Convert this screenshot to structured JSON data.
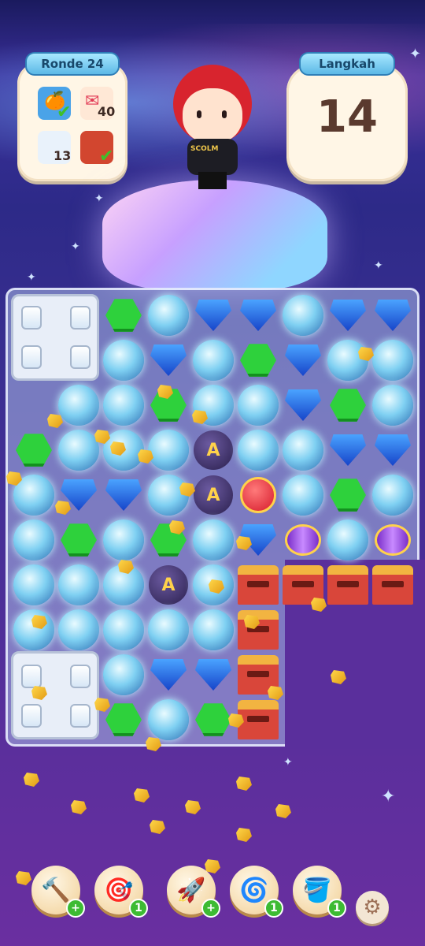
{
  "hud": {
    "round_label": "Ronde 24",
    "moves_label": "Langkah",
    "moves_value": "14",
    "goals": [
      {
        "item": "orange-basket",
        "count": "",
        "completed": true
      },
      {
        "item": "love-letter",
        "count": "40",
        "completed": false
      },
      {
        "item": "milk-jar",
        "count": "13",
        "completed": false
      },
      {
        "item": "gift-box",
        "count": "",
        "completed": true
      }
    ]
  },
  "character": {
    "shirt_text": "SCOLM"
  },
  "board": {
    "dark_tile_symbol": "A",
    "rows": [
      [
        "fridge",
        "fridge",
        "green",
        "bubble",
        "blue",
        "blue",
        "bubble",
        "blue",
        "blue"
      ],
      [
        "fridge",
        "fridge",
        "bubble",
        "blue",
        "bubble",
        "green",
        "blue",
        "bubble",
        "bubble"
      ],
      [
        "empty",
        "bubble",
        "bubble",
        "green",
        "bubble",
        "bubble",
        "blue",
        "green",
        "bubble"
      ],
      [
        "green",
        "bubble",
        "bubble",
        "bubble",
        "dark",
        "bubble",
        "bubble",
        "blue",
        "blue"
      ],
      [
        "bubble",
        "blue",
        "blue",
        "bubble",
        "dark",
        "ball",
        "bubble",
        "green",
        "bubble"
      ],
      [
        "bubble",
        "green",
        "bubble",
        "green",
        "bubble",
        "blue",
        "candy",
        "bubble",
        "candy"
      ],
      [
        "bubble",
        "bubble",
        "bubble",
        "dark",
        "bubble",
        "mailbox",
        "mailbox",
        "mailbox",
        "mailbox"
      ],
      [
        "bubble",
        "bubble",
        "bubble",
        "bubble",
        "bubble",
        "mailbox",
        "",
        "",
        ""
      ],
      [
        "fridge",
        "fridge",
        "bubble",
        "blue",
        "blue",
        "mailbox",
        "",
        "",
        ""
      ],
      [
        "fridge",
        "fridge",
        "green",
        "bubble",
        "green",
        "mailbox",
        "",
        "",
        ""
      ]
    ]
  },
  "boosters": [
    {
      "name": "hammer",
      "badge": "+"
    },
    {
      "name": "cannon",
      "badge": "1"
    },
    {
      "name": "rocket",
      "badge": "+"
    },
    {
      "name": "pinwheel",
      "badge": "1"
    },
    {
      "name": "paint-bucket",
      "badge": "1"
    }
  ],
  "colors": {
    "accent_green": "#3dbb33",
    "hud_tab_blue": "#5cb8e6",
    "bg_purple": "#4b2f98"
  }
}
